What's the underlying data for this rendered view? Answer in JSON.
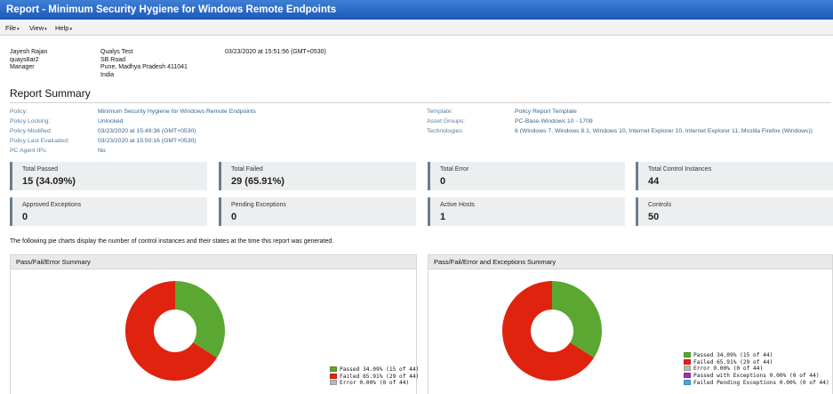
{
  "window": {
    "title": "Report - Minimum Security Hygiene for Windows Remote Endpoints"
  },
  "menu": [
    {
      "label": "File"
    },
    {
      "label": "View"
    },
    {
      "label": "Help"
    }
  ],
  "header": {
    "user_name": "Jayesh Rajan",
    "user_login": "quays8ar2",
    "user_role": "Manager",
    "company": "Qualys Test",
    "address1": "SB Road",
    "address2": "Pune, Madhya Pradesh 411041",
    "country": "India",
    "timestamp": "03/23/2020 at 15:51:56 (GMT+0530)"
  },
  "summary_title": "Report Summary",
  "properties_left": [
    {
      "label": "Policy:",
      "value": "Minimum Security Hygiene for Windows Remote Endpoints"
    },
    {
      "label": "Policy Locking:",
      "value": "Unlocked"
    },
    {
      "label": "Policy Modified:",
      "value": "03/23/2020 at 15:49:36 (GMT+0530)"
    },
    {
      "label": "Policy Last Evaluated:",
      "value": "03/23/2020 at 15:50:16 (GMT+0530)"
    },
    {
      "label": "PC Agent IPs:",
      "value": "No"
    }
  ],
  "properties_right": [
    {
      "label": "Template:",
      "value": "Policy Report Template"
    },
    {
      "label": "Asset Groups:",
      "value": "PC-Base-Windows 10 - 1709"
    },
    {
      "label": "Technologies:",
      "value": "6 (Windows 7, Windows 8.1, Windows 10, Internet Explorer 10, Internet Explorer 11, Mozilla Firefox (Windows))"
    }
  ],
  "cards": [
    {
      "label": "Total Passed",
      "value": "15 (34.09%)"
    },
    {
      "label": "Total Failed",
      "value": "29 (65.91%)"
    },
    {
      "label": "Total Error",
      "value": "0"
    },
    {
      "label": "Total Control Instances",
      "value": "44"
    },
    {
      "label": "Approved Exceptions",
      "value": "0"
    },
    {
      "label": "Pending Exceptions",
      "value": "0"
    },
    {
      "label": "Active Hosts",
      "value": "1"
    },
    {
      "label": "Controls",
      "value": "50"
    }
  ],
  "intro_text": "The following pie charts display the number of control instances and their states at the time this report was generated.",
  "colors": {
    "passed": "#5aa832",
    "failed": "#e0230f",
    "error": "#b8b8b8",
    "passed_exc": "#a12eb5",
    "failed_pending": "#4aa3d6"
  },
  "chart_data": [
    {
      "type": "pie",
      "title": "Pass/Fail/Error Summary",
      "slices": [
        {
          "label": "Passed 34.09% (15 of 44)",
          "value": 15,
          "color": "#5aa832"
        },
        {
          "label": "Failed 65.91% (29 of 44)",
          "value": 29,
          "color": "#e0230f"
        },
        {
          "label": "Error 0.00% (0 of 44)",
          "value": 0,
          "color": "#b8b8b8"
        }
      ]
    },
    {
      "type": "pie",
      "title": "Pass/Fail/Error and Exceptions Summary",
      "slices": [
        {
          "label": "Passed 34.09% (15 of 44)",
          "value": 15,
          "color": "#5aa832"
        },
        {
          "label": "Failed 65.91% (29 of 44)",
          "value": 29,
          "color": "#e0230f"
        },
        {
          "label": "Error 0.00% (0 of 44)",
          "value": 0,
          "color": "#b8b8b8"
        },
        {
          "label": "Passed with Exceptions 0.00% (0 of 44)",
          "value": 0,
          "color": "#a12eb5"
        },
        {
          "label": "Failed Pending Exceptions 0.00% (0 of 44)",
          "value": 0,
          "color": "#4aa3d6"
        }
      ]
    }
  ]
}
